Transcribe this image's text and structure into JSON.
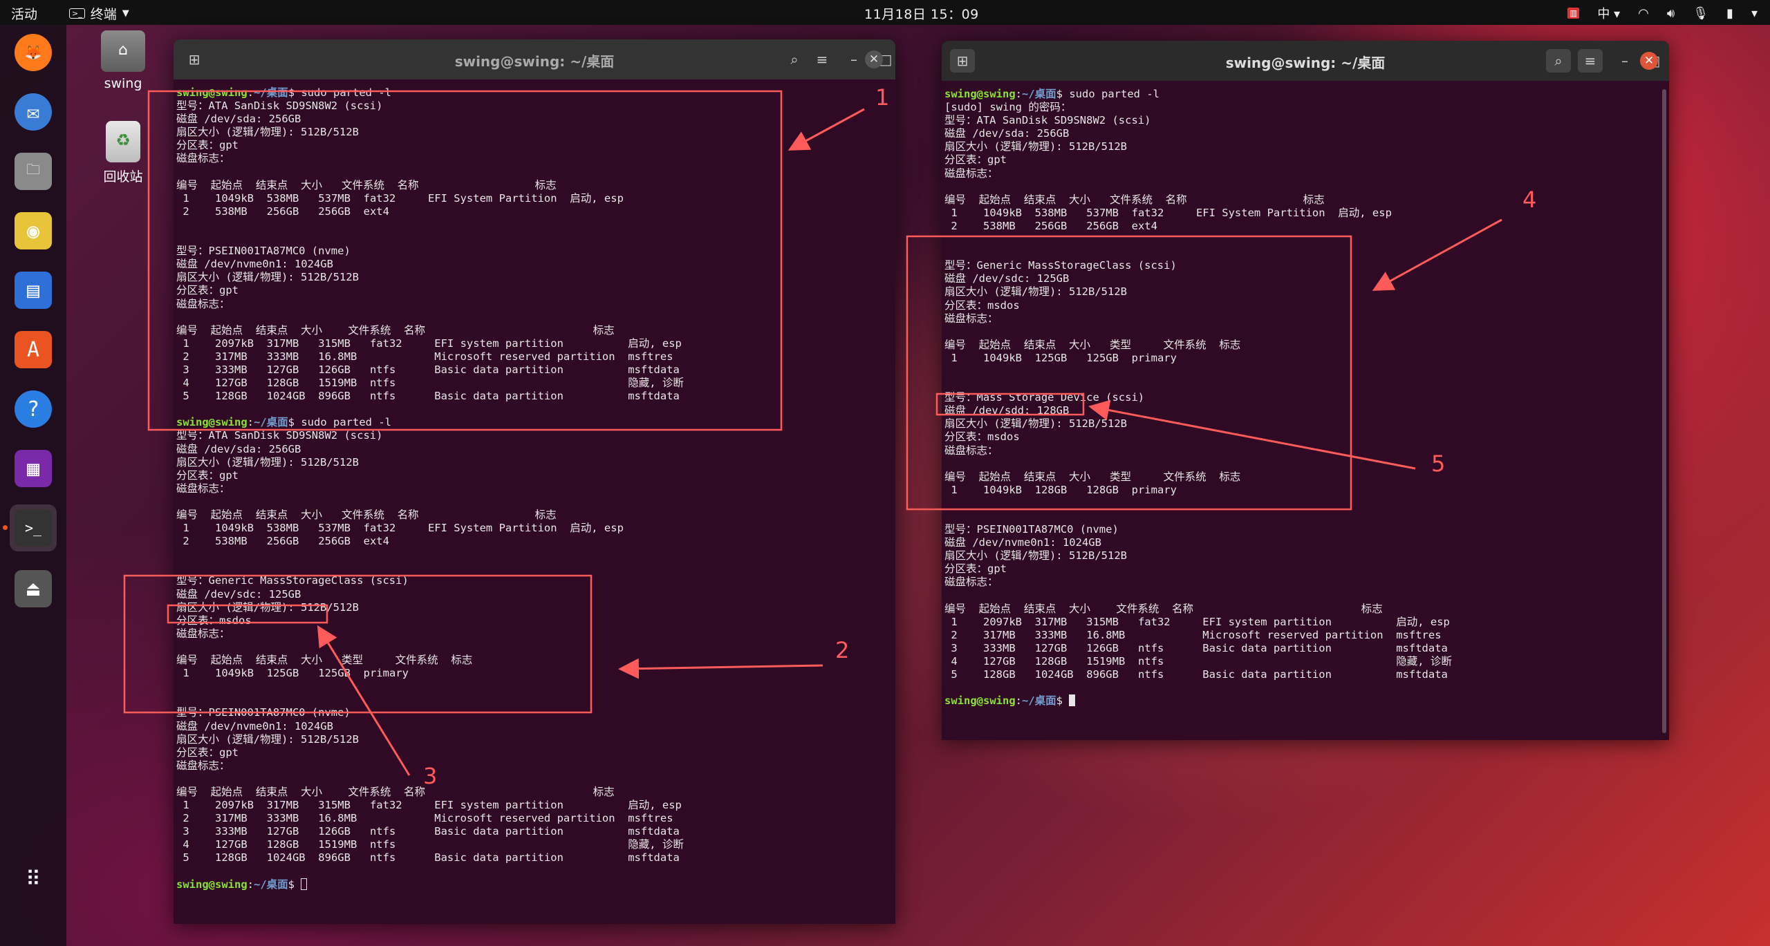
{
  "topbar": {
    "activities": "活动",
    "app_name": "终端",
    "clock": "11月18日  15：09",
    "input_method": "中"
  },
  "desktop": {
    "home_label": "swing",
    "trash_label": "回收站"
  },
  "dock": [
    {
      "name": "firefox-icon",
      "glyph": "🦊"
    },
    {
      "name": "thunderbird-icon",
      "glyph": "✉"
    },
    {
      "name": "files-icon",
      "glyph": "🗀"
    },
    {
      "name": "rhythmbox-icon",
      "glyph": "◉"
    },
    {
      "name": "writer-icon",
      "glyph": "▤"
    },
    {
      "name": "software-center-icon",
      "glyph": "A"
    },
    {
      "name": "help-icon",
      "glyph": "?"
    },
    {
      "name": "video-icon",
      "glyph": "▦"
    },
    {
      "name": "terminal-icon",
      "glyph": ">_"
    },
    {
      "name": "usb-drive-icon",
      "glyph": "⏏"
    },
    {
      "name": "show-apps-icon",
      "glyph": "⠿"
    }
  ],
  "left_terminal": {
    "title": "swing@swing: ~/桌面",
    "lines": [
      [
        {
          "t": "swing@swing",
          "c": "pu"
        },
        {
          "t": ":",
          "c": ""
        },
        {
          "t": "~/桌面",
          "c": "pp"
        },
        {
          "t": "$ sudo parted -l",
          "c": ""
        }
      ],
      [
        {
          "t": "型号：ATA SanDisk SD9SN8W2 (scsi)",
          "c": ""
        }
      ],
      [
        {
          "t": "磁盘 /dev/sda: 256GB",
          "c": ""
        }
      ],
      [
        {
          "t": "扇区大小 (逻辑/物理): 512B/512B",
          "c": ""
        }
      ],
      [
        {
          "t": "分区表：gpt",
          "c": ""
        }
      ],
      [
        {
          "t": "磁盘标志：",
          "c": ""
        }
      ],
      [
        {
          "t": "",
          "c": ""
        }
      ],
      [
        {
          "t": "编号  起始点  结束点  大小   文件系统  名称                  标志",
          "c": ""
        }
      ],
      [
        {
          "t": " 1    1049kB  538MB   537MB  fat32     EFI System Partition  启动, esp",
          "c": ""
        }
      ],
      [
        {
          "t": " 2    538MB   256GB   256GB  ext4",
          "c": ""
        }
      ],
      [
        {
          "t": "",
          "c": ""
        }
      ],
      [
        {
          "t": "",
          "c": ""
        }
      ],
      [
        {
          "t": "型号：PSEIN001TA87MC0 (nvme)",
          "c": ""
        }
      ],
      [
        {
          "t": "磁盘 /dev/nvme0n1: 1024GB",
          "c": ""
        }
      ],
      [
        {
          "t": "扇区大小 (逻辑/物理): 512B/512B",
          "c": ""
        }
      ],
      [
        {
          "t": "分区表：gpt",
          "c": ""
        }
      ],
      [
        {
          "t": "磁盘标志：",
          "c": ""
        }
      ],
      [
        {
          "t": "",
          "c": ""
        }
      ],
      [
        {
          "t": "编号  起始点  结束点  大小    文件系统  名称                          标志",
          "c": ""
        }
      ],
      [
        {
          "t": " 1    2097kB  317MB   315MB   fat32     EFI system partition          启动, esp",
          "c": ""
        }
      ],
      [
        {
          "t": " 2    317MB   333MB   16.8MB            Microsoft reserved partition  msftres",
          "c": ""
        }
      ],
      [
        {
          "t": " 3    333MB   127GB   126GB   ntfs      Basic data partition          msftdata",
          "c": ""
        }
      ],
      [
        {
          "t": " 4    127GB   128GB   1519MB  ntfs                                    隐藏, 诊断",
          "c": ""
        }
      ],
      [
        {
          "t": " 5    128GB   1024GB  896GB   ntfs      Basic data partition          msftdata",
          "c": ""
        }
      ],
      [
        {
          "t": "",
          "c": ""
        }
      ],
      [
        {
          "t": "swing@swing",
          "c": "pu"
        },
        {
          "t": ":",
          "c": ""
        },
        {
          "t": "~/桌面",
          "c": "pp"
        },
        {
          "t": "$ sudo parted -l",
          "c": ""
        }
      ],
      [
        {
          "t": "型号：ATA SanDisk SD9SN8W2 (scsi)",
          "c": ""
        }
      ],
      [
        {
          "t": "磁盘 /dev/sda: 256GB",
          "c": ""
        }
      ],
      [
        {
          "t": "扇区大小 (逻辑/物理): 512B/512B",
          "c": ""
        }
      ],
      [
        {
          "t": "分区表：gpt",
          "c": ""
        }
      ],
      [
        {
          "t": "磁盘标志：",
          "c": ""
        }
      ],
      [
        {
          "t": "",
          "c": ""
        }
      ],
      [
        {
          "t": "编号  起始点  结束点  大小   文件系统  名称                  标志",
          "c": ""
        }
      ],
      [
        {
          "t": " 1    1049kB  538MB   537MB  fat32     EFI System Partition  启动, esp",
          "c": ""
        }
      ],
      [
        {
          "t": " 2    538MB   256GB   256GB  ext4",
          "c": ""
        }
      ],
      [
        {
          "t": "",
          "c": ""
        }
      ],
      [
        {
          "t": "",
          "c": ""
        }
      ],
      [
        {
          "t": "型号：Generic MassStorageClass (scsi)",
          "c": ""
        }
      ],
      [
        {
          "t": "磁盘 /dev/sdc: 125GB",
          "c": ""
        }
      ],
      [
        {
          "t": "扇区大小 (逻辑/物理): 512B/512B",
          "c": ""
        }
      ],
      [
        {
          "t": "分区表：msdos",
          "c": ""
        }
      ],
      [
        {
          "t": "磁盘标志：",
          "c": ""
        }
      ],
      [
        {
          "t": "",
          "c": ""
        }
      ],
      [
        {
          "t": "编号  起始点  结束点  大小   类型     文件系统  标志",
          "c": ""
        }
      ],
      [
        {
          "t": " 1    1049kB  125GB   125GB  primary",
          "c": ""
        }
      ],
      [
        {
          "t": "",
          "c": ""
        }
      ],
      [
        {
          "t": "",
          "c": ""
        }
      ],
      [
        {
          "t": "型号：PSEIN001TA87MC0 (nvme)",
          "c": ""
        }
      ],
      [
        {
          "t": "磁盘 /dev/nvme0n1: 1024GB",
          "c": ""
        }
      ],
      [
        {
          "t": "扇区大小 (逻辑/物理): 512B/512B",
          "c": ""
        }
      ],
      [
        {
          "t": "分区表：gpt",
          "c": ""
        }
      ],
      [
        {
          "t": "磁盘标志：",
          "c": ""
        }
      ],
      [
        {
          "t": "",
          "c": ""
        }
      ],
      [
        {
          "t": "编号  起始点  结束点  大小    文件系统  名称                          标志",
          "c": ""
        }
      ],
      [
        {
          "t": " 1    2097kB  317MB   315MB   fat32     EFI system partition          启动, esp",
          "c": ""
        }
      ],
      [
        {
          "t": " 2    317MB   333MB   16.8MB            Microsoft reserved partition  msftres",
          "c": ""
        }
      ],
      [
        {
          "t": " 3    333MB   127GB   126GB   ntfs      Basic data partition          msftdata",
          "c": ""
        }
      ],
      [
        {
          "t": " 4    127GB   128GB   1519MB  ntfs                                    隐藏, 诊断",
          "c": ""
        }
      ],
      [
        {
          "t": " 5    128GB   1024GB  896GB   ntfs      Basic data partition          msftdata",
          "c": ""
        }
      ],
      [
        {
          "t": "",
          "c": ""
        }
      ],
      [
        {
          "t": "swing@swing",
          "c": "pu"
        },
        {
          "t": ":",
          "c": ""
        },
        {
          "t": "~/桌面",
          "c": "pp"
        },
        {
          "t": "$ ",
          "c": ""
        },
        {
          "t": "",
          "c": "cursor-hollow"
        }
      ]
    ]
  },
  "right_terminal": {
    "title": "swing@swing: ~/桌面",
    "lines": [
      [
        {
          "t": "swing@swing",
          "c": "pu"
        },
        {
          "t": ":",
          "c": ""
        },
        {
          "t": "~/桌面",
          "c": "pp"
        },
        {
          "t": "$ sudo parted -l",
          "c": ""
        }
      ],
      [
        {
          "t": "[sudo] swing 的密码：",
          "c": ""
        }
      ],
      [
        {
          "t": "型号：ATA SanDisk SD9SN8W2 (scsi)",
          "c": ""
        }
      ],
      [
        {
          "t": "磁盘 /dev/sda: 256GB",
          "c": ""
        }
      ],
      [
        {
          "t": "扇区大小 (逻辑/物理): 512B/512B",
          "c": ""
        }
      ],
      [
        {
          "t": "分区表：gpt",
          "c": ""
        }
      ],
      [
        {
          "t": "磁盘标志：",
          "c": ""
        }
      ],
      [
        {
          "t": "",
          "c": ""
        }
      ],
      [
        {
          "t": "编号  起始点  结束点  大小   文件系统  名称                  标志",
          "c": ""
        }
      ],
      [
        {
          "t": " 1    1049kB  538MB   537MB  fat32     EFI System Partition  启动, esp",
          "c": ""
        }
      ],
      [
        {
          "t": " 2    538MB   256GB   256GB  ext4",
          "c": ""
        }
      ],
      [
        {
          "t": "",
          "c": ""
        }
      ],
      [
        {
          "t": "",
          "c": ""
        }
      ],
      [
        {
          "t": "型号：Generic MassStorageClass (scsi)",
          "c": ""
        }
      ],
      [
        {
          "t": "磁盘 /dev/sdc: 125GB",
          "c": ""
        }
      ],
      [
        {
          "t": "扇区大小 (逻辑/物理): 512B/512B",
          "c": ""
        }
      ],
      [
        {
          "t": "分区表：msdos",
          "c": ""
        }
      ],
      [
        {
          "t": "磁盘标志：",
          "c": ""
        }
      ],
      [
        {
          "t": "",
          "c": ""
        }
      ],
      [
        {
          "t": "编号  起始点  结束点  大小   类型     文件系统  标志",
          "c": ""
        }
      ],
      [
        {
          "t": " 1    1049kB  125GB   125GB  primary",
          "c": ""
        }
      ],
      [
        {
          "t": "",
          "c": ""
        }
      ],
      [
        {
          "t": "",
          "c": ""
        }
      ],
      [
        {
          "t": "型号：Mass Storage Device (scsi)",
          "c": ""
        }
      ],
      [
        {
          "t": "磁盘 /dev/sdd: 128GB",
          "c": ""
        }
      ],
      [
        {
          "t": "扇区大小 (逻辑/物理): 512B/512B",
          "c": ""
        }
      ],
      [
        {
          "t": "分区表：msdos",
          "c": ""
        }
      ],
      [
        {
          "t": "磁盘标志：",
          "c": ""
        }
      ],
      [
        {
          "t": "",
          "c": ""
        }
      ],
      [
        {
          "t": "编号  起始点  结束点  大小   类型     文件系统  标志",
          "c": ""
        }
      ],
      [
        {
          "t": " 1    1049kB  128GB   128GB  primary",
          "c": ""
        }
      ],
      [
        {
          "t": "",
          "c": ""
        }
      ],
      [
        {
          "t": "",
          "c": ""
        }
      ],
      [
        {
          "t": "型号：PSEIN001TA87MC0 (nvme)",
          "c": ""
        }
      ],
      [
        {
          "t": "磁盘 /dev/nvme0n1: 1024GB",
          "c": ""
        }
      ],
      [
        {
          "t": "扇区大小 (逻辑/物理): 512B/512B",
          "c": ""
        }
      ],
      [
        {
          "t": "分区表：gpt",
          "c": ""
        }
      ],
      [
        {
          "t": "磁盘标志：",
          "c": ""
        }
      ],
      [
        {
          "t": "",
          "c": ""
        }
      ],
      [
        {
          "t": "编号  起始点  结束点  大小    文件系统  名称                          标志",
          "c": ""
        }
      ],
      [
        {
          "t": " 1    2097kB  317MB   315MB   fat32     EFI system partition          启动, esp",
          "c": ""
        }
      ],
      [
        {
          "t": " 2    317MB   333MB   16.8MB            Microsoft reserved partition  msftres",
          "c": ""
        }
      ],
      [
        {
          "t": " 3    333MB   127GB   126GB   ntfs      Basic data partition          msftdata",
          "c": ""
        }
      ],
      [
        {
          "t": " 4    127GB   128GB   1519MB  ntfs                                    隐藏, 诊断",
          "c": ""
        }
      ],
      [
        {
          "t": " 5    128GB   1024GB  896GB   ntfs      Basic data partition          msftdata",
          "c": ""
        }
      ],
      [
        {
          "t": "",
          "c": ""
        }
      ],
      [
        {
          "t": "swing@swing",
          "c": "pu"
        },
        {
          "t": ":",
          "c": ""
        },
        {
          "t": "~/桌面",
          "c": "pp"
        },
        {
          "t": "$ ",
          "c": ""
        },
        {
          "t": "",
          "c": "cursor-block"
        }
      ]
    ]
  },
  "annotations": {
    "labels": [
      "1",
      "2",
      "3",
      "4",
      "5"
    ],
    "color": "#ff5b5b"
  }
}
